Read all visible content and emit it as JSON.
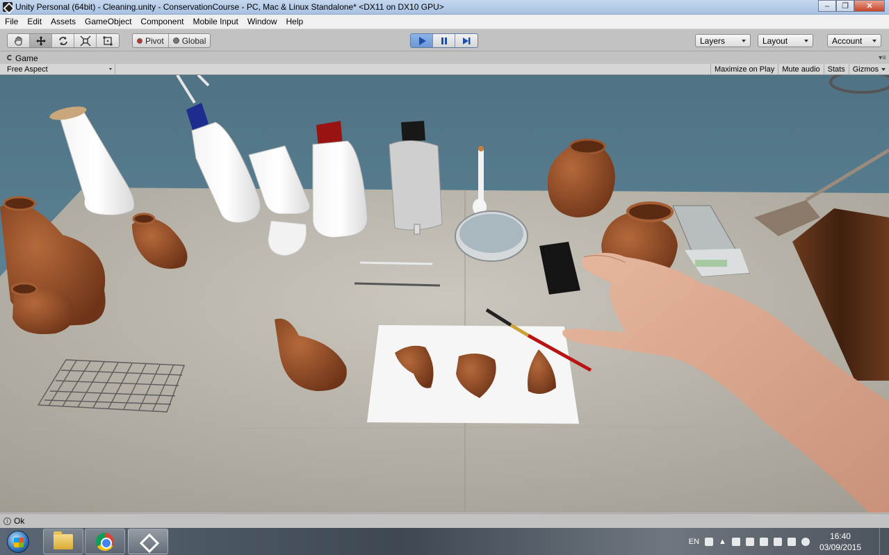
{
  "window": {
    "title": "Unity Personal (64bit) - Cleaning.unity - ConservationCourse - PC, Mac & Linux Standalone* <DX11 on DX10 GPU>"
  },
  "menu": [
    "File",
    "Edit",
    "Assets",
    "GameObject",
    "Component",
    "Mobile Input",
    "Window",
    "Help"
  ],
  "toolbar": {
    "tools": [
      "hand-icon",
      "move-icon",
      "rotate-icon",
      "scale-icon",
      "rect-icon"
    ],
    "active_tool": "move-icon",
    "pivot_label": "Pivot",
    "global_label": "Global",
    "playback": [
      "play-icon",
      "pause-icon",
      "step-icon"
    ],
    "playing": true,
    "layers_label": "Layers",
    "layout_label": "Layout",
    "account_label": "Account"
  },
  "game_panel": {
    "tab_label": "Game",
    "aspect_label": "Free Aspect",
    "maximize_label": "Maximize on Play",
    "mute_label": "Mute audio",
    "stats_label": "Stats",
    "gizmos_label": "Gizmos"
  },
  "status": {
    "message": "Ok"
  },
  "taskbar": {
    "apps": [
      "folder-icon",
      "chrome-icon",
      "unity-icon"
    ],
    "language": "EN",
    "time": "16:40",
    "date": "03/09/2015"
  },
  "colors": {
    "editor_gray": "#c2c2c2",
    "sky_blue": "#5a7f92",
    "table_beige": "#aaa59b",
    "play_active": "#6b96d6"
  }
}
